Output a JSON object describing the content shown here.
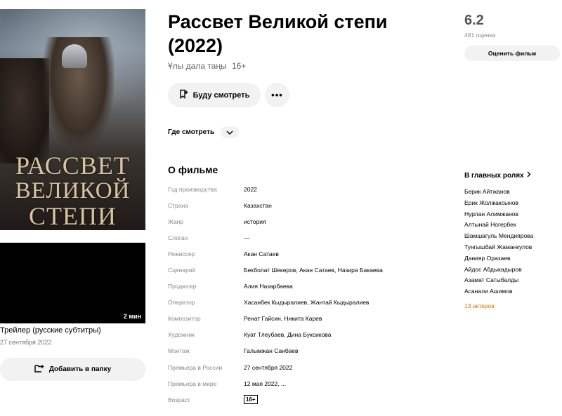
{
  "poster": {
    "art_line1": "РАССВЕТ",
    "art_line2": "ВЕЛИКОЙ",
    "art_line3": "СТЕПИ"
  },
  "trailer": {
    "duration": "2 мин",
    "title": "Трейлер (русские субтитры)",
    "date": "27 сентября 2022"
  },
  "folder_button": "Добавить в папку",
  "movie": {
    "title": "Рассвет Великой степи (2022)",
    "original_title": "Ұлы дала таңы",
    "age": "16+"
  },
  "actions": {
    "watch_later": "Буду смотреть",
    "more": "•••",
    "where_to_watch": "Где смотреть"
  },
  "about": {
    "heading": "О фильме",
    "facts": [
      {
        "key": "Год производства",
        "value": "2022"
      },
      {
        "key": "Страна",
        "value": "Казахстан"
      },
      {
        "key": "Жанр",
        "value": "история"
      },
      {
        "key": "Слоган",
        "value": "—"
      },
      {
        "key": "Режиссер",
        "value": "Акан Сатаев"
      },
      {
        "key": "Сценарий",
        "value": "Бекболат Шекеров, Акан Сатаев, Назира Бакаева"
      },
      {
        "key": "Продюсер",
        "value": "Алия Назарбаева"
      },
      {
        "key": "Оператор",
        "value": "Хасанбек Кыдыралиев, Жантай Кыдыралиев"
      },
      {
        "key": "Композитор",
        "value": "Ренат Гайсин, Никита Карев"
      },
      {
        "key": "Художник",
        "value": "Куат Тлеубаев, Дина Буксикова"
      },
      {
        "key": "Монтаж",
        "value": "Галымжан Санбаев"
      },
      {
        "key": "Премьера в России",
        "value": "27 сентября 2022"
      },
      {
        "key": "Премьера в мире",
        "value": "12 мая 2022, ..."
      },
      {
        "key": "Возраст",
        "value": "16+"
      }
    ]
  },
  "rating": {
    "value": "6.2",
    "count": "481 оценка",
    "rate_button": "Оценить фильм"
  },
  "cast": {
    "heading": "В главных ролях",
    "actors": [
      "Берик Айтжанов",
      "Ерик Жолжаксынов",
      "Нурлан Алимжанов",
      "Алтынай Ногербек",
      "Шамшагуль Мендиярова",
      "Тунгышбай Жаманкулов",
      "Данияр Оразаев",
      "Айдос Абдыкадыров",
      "Азамат Сатыбалды",
      "Асанали Ашимов"
    ],
    "more": "13 актеров"
  },
  "colors": {
    "accent_orange": "#e07000",
    "button_bg": "#f2f2f2",
    "muted_text": "#888888"
  }
}
